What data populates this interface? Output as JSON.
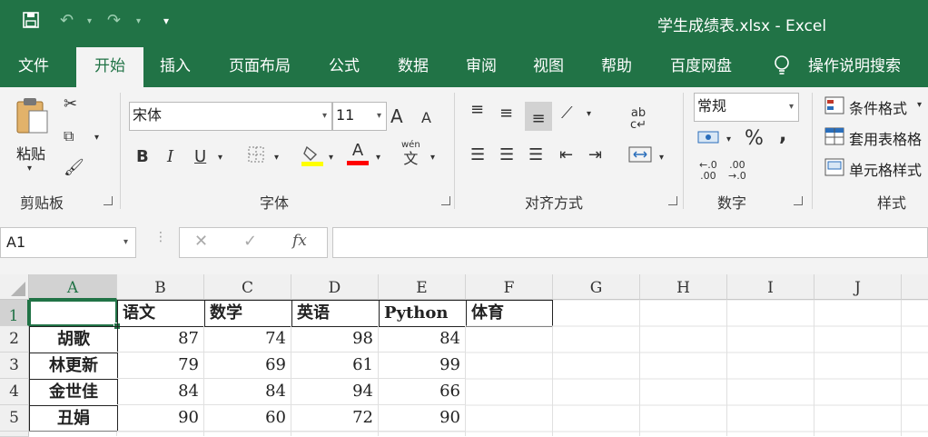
{
  "app": {
    "title": "学生成绩表.xlsx  -  Excel"
  },
  "quick_access": {
    "save_icon": "save-icon",
    "undo_icon": "undo-icon",
    "redo_icon": "redo-icon",
    "customize_icon": "customize-icon"
  },
  "tabs": [
    {
      "label": "文件"
    },
    {
      "label": "开始"
    },
    {
      "label": "插入"
    },
    {
      "label": "页面布局"
    },
    {
      "label": "公式"
    },
    {
      "label": "数据"
    },
    {
      "label": "审阅"
    },
    {
      "label": "视图"
    },
    {
      "label": "帮助"
    },
    {
      "label": "百度网盘"
    }
  ],
  "tell_me": "操作说明搜索",
  "ribbon": {
    "clipboard": {
      "label": "剪贴板",
      "paste": "粘贴"
    },
    "font": {
      "label": "字体",
      "name": "宋体",
      "size": "11",
      "bold": "B",
      "italic": "I",
      "underline": "U",
      "grow": "A",
      "shrink": "A",
      "color_letter": "A",
      "wen": "wén",
      "wen2": "文"
    },
    "alignment": {
      "label": "对齐方式"
    },
    "number": {
      "label": "数字",
      "format": "常规",
      "percent": "%",
      "comma": ","
    },
    "styles": {
      "label": "样式",
      "conditional": "条件格式",
      "table": "套用表格格",
      "cell": "单元格样式"
    }
  },
  "formula_bar": {
    "name_box": "A1",
    "cancel": "✕",
    "enter": "✓",
    "fx": "fx",
    "formula": ""
  },
  "colors": {
    "brand": "#217346",
    "fill_yellow": "#ffff00",
    "font_red": "#ff0000"
  },
  "sheet": {
    "columns": [
      "A",
      "B",
      "C",
      "D",
      "E",
      "F",
      "G",
      "H",
      "I",
      "J"
    ],
    "rows": [
      "1",
      "2",
      "3",
      "4",
      "5"
    ],
    "header_row": [
      "",
      "语文",
      "数学",
      "英语",
      "Python",
      "体育"
    ],
    "data": [
      [
        "胡歌",
        "87",
        "74",
        "98",
        "84",
        ""
      ],
      [
        "林更新",
        "79",
        "69",
        "61",
        "99",
        ""
      ],
      [
        "金世佳",
        "84",
        "84",
        "94",
        "66",
        ""
      ],
      [
        "丑娟",
        "90",
        "60",
        "72",
        "90",
        ""
      ]
    ]
  }
}
